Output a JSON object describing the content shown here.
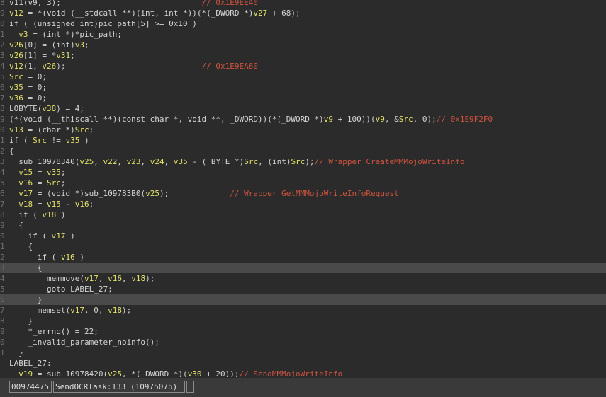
{
  "editor": {
    "lines": [
      {
        "gutter": "8",
        "highlight": false,
        "tokens": [
          [
            "v11(v9, 3);",
            "txt"
          ],
          [
            "                              // 0x1E9EE40",
            "cmt"
          ]
        ]
      },
      {
        "gutter": "9",
        "highlight": false,
        "tokens": [
          [
            "v12",
            "var"
          ],
          [
            " = *(void (__stdcall **)(int, int *))(*(_DWORD *)",
            "txt"
          ],
          [
            "v27",
            "var"
          ],
          [
            " + 68);",
            "txt"
          ]
        ]
      },
      {
        "gutter": "0",
        "highlight": false,
        "tokens": [
          [
            "if ( (unsigned int)pic_path[5] >= 0x10 )",
            "txt"
          ]
        ]
      },
      {
        "gutter": "1",
        "highlight": false,
        "tokens": [
          [
            "  ",
            "txt"
          ],
          [
            "v3",
            "var"
          ],
          [
            " = (int *)*pic_path;",
            "txt"
          ]
        ]
      },
      {
        "gutter": "2",
        "highlight": false,
        "tokens": [
          [
            "v26",
            "var"
          ],
          [
            "[0] = (int)",
            "txt"
          ],
          [
            "v3",
            "var"
          ],
          [
            ";",
            "txt"
          ]
        ]
      },
      {
        "gutter": "3",
        "highlight": false,
        "tokens": [
          [
            "v26",
            "var"
          ],
          [
            "[1] = *",
            "txt"
          ],
          [
            "v31",
            "var"
          ],
          [
            ";",
            "txt"
          ]
        ]
      },
      {
        "gutter": "4",
        "highlight": false,
        "tokens": [
          [
            "v12",
            "var"
          ],
          [
            "(1, ",
            "txt"
          ],
          [
            "v26",
            "var"
          ],
          [
            ");",
            "txt"
          ],
          [
            "                             // 0x1E9EA60",
            "cmt"
          ]
        ]
      },
      {
        "gutter": "5",
        "highlight": false,
        "tokens": [
          [
            "Src",
            "var"
          ],
          [
            " = 0;",
            "txt"
          ]
        ]
      },
      {
        "gutter": "6",
        "highlight": false,
        "tokens": [
          [
            "v35",
            "var"
          ],
          [
            " = 0;",
            "txt"
          ]
        ]
      },
      {
        "gutter": "7",
        "highlight": false,
        "tokens": [
          [
            "v36",
            "var"
          ],
          [
            " = 0;",
            "txt"
          ]
        ]
      },
      {
        "gutter": "8",
        "highlight": false,
        "tokens": [
          [
            "LOBYTE(",
            "txt"
          ],
          [
            "v38",
            "var"
          ],
          [
            ") = 4;",
            "txt"
          ]
        ]
      },
      {
        "gutter": "9",
        "highlight": false,
        "tokens": [
          [
            "(*(void (__thiscall **)(const char *, void **, _DWORD))(*(_DWORD *)",
            "txt"
          ],
          [
            "v9",
            "var"
          ],
          [
            " + 100))(",
            "txt"
          ],
          [
            "v9",
            "var"
          ],
          [
            ", &",
            "txt"
          ],
          [
            "Src",
            "var"
          ],
          [
            ", 0);",
            "txt"
          ],
          [
            "// 0x1E9F2F0",
            "cmt"
          ]
        ]
      },
      {
        "gutter": "0",
        "highlight": false,
        "tokens": [
          [
            "v13",
            "var"
          ],
          [
            " = (char *)",
            "txt"
          ],
          [
            "Src",
            "var"
          ],
          [
            ";",
            "txt"
          ]
        ]
      },
      {
        "gutter": "1",
        "highlight": false,
        "tokens": [
          [
            "if ( ",
            "txt"
          ],
          [
            "Src",
            "var"
          ],
          [
            " != ",
            "txt"
          ],
          [
            "v35",
            "var"
          ],
          [
            " )",
            "txt"
          ]
        ]
      },
      {
        "gutter": "2",
        "highlight": false,
        "tokens": [
          [
            "{",
            "txt"
          ]
        ]
      },
      {
        "gutter": "3",
        "highlight": false,
        "tokens": [
          [
            "  sub_10978340(",
            "txt"
          ],
          [
            "v25",
            "var"
          ],
          [
            ", ",
            "txt"
          ],
          [
            "v22",
            "var"
          ],
          [
            ", ",
            "txt"
          ],
          [
            "v23",
            "var"
          ],
          [
            ", ",
            "txt"
          ],
          [
            "v24",
            "var"
          ],
          [
            ", ",
            "txt"
          ],
          [
            "v35",
            "var"
          ],
          [
            " - (_BYTE *)",
            "txt"
          ],
          [
            "Src",
            "var"
          ],
          [
            ", (int)",
            "txt"
          ],
          [
            "Src",
            "var"
          ],
          [
            ");",
            "txt"
          ],
          [
            "// Wrapper CreateMMMojoWriteInfo",
            "cmt"
          ]
        ]
      },
      {
        "gutter": "4",
        "highlight": false,
        "tokens": [
          [
            "  ",
            "txt"
          ],
          [
            "v15",
            "var"
          ],
          [
            " = ",
            "txt"
          ],
          [
            "v35",
            "var"
          ],
          [
            ";",
            "txt"
          ]
        ]
      },
      {
        "gutter": "5",
        "highlight": false,
        "tokens": [
          [
            "  ",
            "txt"
          ],
          [
            "v16",
            "var"
          ],
          [
            " = ",
            "txt"
          ],
          [
            "Src",
            "var"
          ],
          [
            ";",
            "txt"
          ]
        ]
      },
      {
        "gutter": "6",
        "highlight": false,
        "tokens": [
          [
            "  ",
            "txt"
          ],
          [
            "v17",
            "var"
          ],
          [
            " = (void *)sub_109783B0(",
            "txt"
          ],
          [
            "v25",
            "var"
          ],
          [
            ");",
            "txt"
          ],
          [
            "             // Wrapper GetMMMojoWriteInfoRequest",
            "cmt"
          ]
        ]
      },
      {
        "gutter": "7",
        "highlight": false,
        "tokens": [
          [
            "  ",
            "txt"
          ],
          [
            "v18",
            "var"
          ],
          [
            " = ",
            "txt"
          ],
          [
            "v15",
            "var"
          ],
          [
            " - ",
            "txt"
          ],
          [
            "v16",
            "var"
          ],
          [
            ";",
            "txt"
          ]
        ]
      },
      {
        "gutter": "8",
        "highlight": false,
        "tokens": [
          [
            "  if ( ",
            "txt"
          ],
          [
            "v18",
            "var"
          ],
          [
            " )",
            "txt"
          ]
        ]
      },
      {
        "gutter": "9",
        "highlight": false,
        "tokens": [
          [
            "  {",
            "txt"
          ]
        ]
      },
      {
        "gutter": "0",
        "highlight": false,
        "tokens": [
          [
            "    if ( ",
            "txt"
          ],
          [
            "v17",
            "var"
          ],
          [
            " )",
            "txt"
          ]
        ]
      },
      {
        "gutter": "1",
        "highlight": false,
        "tokens": [
          [
            "    {",
            "txt"
          ]
        ]
      },
      {
        "gutter": "2",
        "highlight": false,
        "tokens": [
          [
            "      if ( ",
            "txt"
          ],
          [
            "v16",
            "var"
          ],
          [
            " )",
            "txt"
          ]
        ]
      },
      {
        "gutter": "3",
        "highlight": true,
        "tokens": [
          [
            "      {",
            "txt"
          ]
        ]
      },
      {
        "gutter": "4",
        "highlight": false,
        "tokens": [
          [
            "        memmove(",
            "txt"
          ],
          [
            "v17",
            "var"
          ],
          [
            ", ",
            "txt"
          ],
          [
            "v16",
            "var"
          ],
          [
            ", ",
            "txt"
          ],
          [
            "v18",
            "var"
          ],
          [
            ");",
            "txt"
          ]
        ]
      },
      {
        "gutter": "5",
        "highlight": false,
        "tokens": [
          [
            "        goto LABEL_27;",
            "txt"
          ]
        ]
      },
      {
        "gutter": "6",
        "highlight": true,
        "tokens": [
          [
            "      }",
            "txt"
          ]
        ]
      },
      {
        "gutter": "7",
        "highlight": false,
        "tokens": [
          [
            "      memset(",
            "txt"
          ],
          [
            "v17",
            "var"
          ],
          [
            ", 0, ",
            "txt"
          ],
          [
            "v18",
            "var"
          ],
          [
            ");",
            "txt"
          ]
        ]
      },
      {
        "gutter": "8",
        "highlight": false,
        "tokens": [
          [
            "    }",
            "txt"
          ]
        ]
      },
      {
        "gutter": "9",
        "highlight": false,
        "tokens": [
          [
            "    *_errno() = 22;",
            "txt"
          ]
        ]
      },
      {
        "gutter": "0",
        "highlight": false,
        "tokens": [
          [
            "    _invalid_parameter_noinfo();",
            "txt"
          ]
        ]
      },
      {
        "gutter": "1",
        "highlight": false,
        "tokens": [
          [
            "  }",
            "txt"
          ]
        ]
      },
      {
        "gutter": "",
        "highlight": false,
        "tokens": [
          [
            "LABEL_27:",
            "lbl"
          ]
        ]
      },
      {
        "gutter": "",
        "highlight": false,
        "tokens": [
          [
            "  ",
            "txt"
          ],
          [
            "v19",
            "var"
          ],
          [
            " = sub_10978420(",
            "txt"
          ],
          [
            "v25",
            "var"
          ],
          [
            ", *(_DWORD *)(",
            "txt"
          ],
          [
            "v30",
            "var"
          ],
          [
            " + 20));",
            "txt"
          ],
          [
            "// SendMMMojoWriteInfo",
            "cmt"
          ]
        ]
      }
    ]
  },
  "statusbar": {
    "address": "00974475",
    "function": "SendOCRTask:133 (10975075)",
    "extra": ""
  },
  "colors": {
    "background": "#2b2b2b",
    "variable": "#e4e16a",
    "comment": "#d0533f",
    "text": "#d4d4d4",
    "highlight_line": "#4a4a4a"
  }
}
